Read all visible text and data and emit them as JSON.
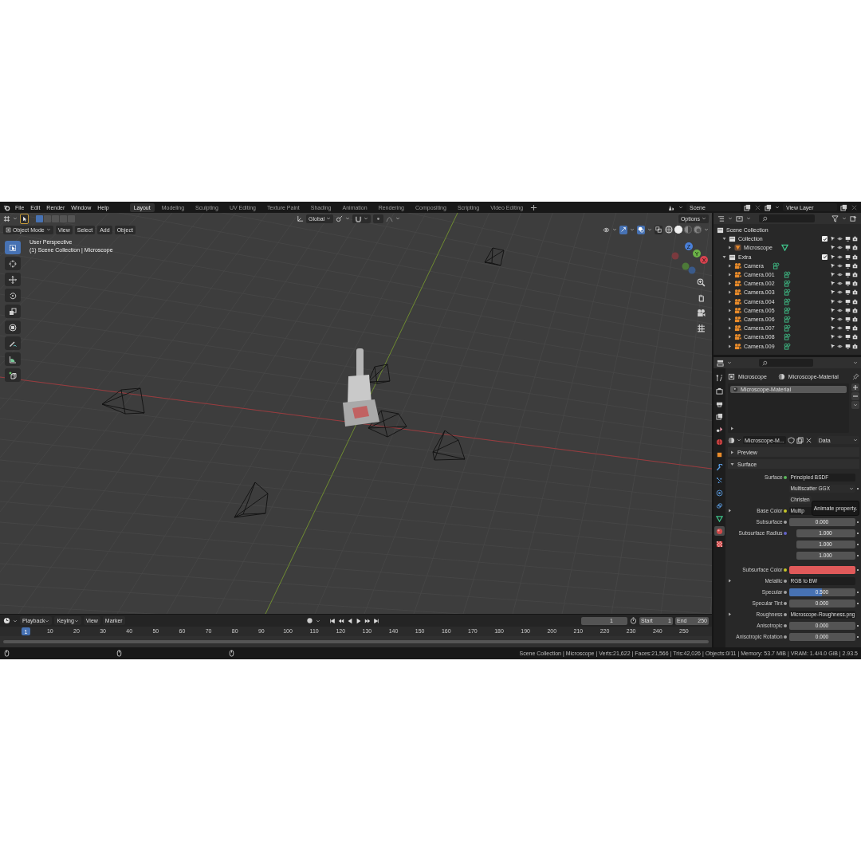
{
  "topbar": {
    "menus": [
      "File",
      "Edit",
      "Render",
      "Window",
      "Help"
    ],
    "workspaces": [
      {
        "label": "Layout",
        "selected": true
      },
      {
        "label": "Modeling",
        "selected": false
      },
      {
        "label": "Sculpting",
        "selected": false
      },
      {
        "label": "UV Editing",
        "selected": false
      },
      {
        "label": "Texture Paint",
        "selected": false
      },
      {
        "label": "Shading",
        "selected": false
      },
      {
        "label": "Animation",
        "selected": false
      },
      {
        "label": "Rendering",
        "selected": false
      },
      {
        "label": "Compositing",
        "selected": false
      },
      {
        "label": "Scripting",
        "selected": false
      },
      {
        "label": "Video Editing",
        "selected": false
      }
    ],
    "scene": "Scene",
    "view_layer": "View Layer"
  },
  "viewport": {
    "select_modes": [
      {
        "selected": true
      },
      {
        "selected": false
      },
      {
        "selected": false
      },
      {
        "selected": false
      },
      {
        "selected": false
      }
    ],
    "orientation": "Global",
    "snap_on": false,
    "proportional_on": false,
    "options": "Options",
    "mode": "Object Mode",
    "menus": [
      "View",
      "Select",
      "Add",
      "Object"
    ],
    "toggles": [
      {
        "kind": "gizmo",
        "on": true
      },
      {
        "kind": "overlay",
        "on": true
      },
      {
        "kind": "xray",
        "on": false
      }
    ],
    "shading": [
      {
        "kind": "wireframe",
        "selected": false
      },
      {
        "kind": "solid",
        "selected": true
      },
      {
        "kind": "material",
        "selected": false
      },
      {
        "kind": "rendered",
        "selected": false
      }
    ],
    "info": [
      "User Perspective",
      "(1) Scene Collection | Microscope"
    ],
    "tools": [
      {
        "kind": "select",
        "selected": true
      },
      {
        "kind": "cursor",
        "selected": false
      },
      {
        "kind": "move",
        "selected": false
      },
      {
        "kind": "rotate",
        "selected": false
      },
      {
        "kind": "scale",
        "selected": false
      },
      {
        "kind": "transform",
        "selected": false
      },
      {
        "kind": "annotate",
        "selected": false
      },
      {
        "kind": "measure",
        "selected": false
      },
      {
        "kind": "add_cube",
        "selected": false
      }
    ],
    "gizmo_axes": [
      "Z",
      "Y",
      "X"
    ]
  },
  "outliner": {
    "root": {
      "label": "Scene Collection",
      "children": [
        {
          "label": "Collection",
          "kind": "collection",
          "expanded": true,
          "checked": true,
          "children": [
            {
              "label": "Microscope",
              "kind": "mesh",
              "expanded": false
            }
          ]
        },
        {
          "label": "Extra",
          "kind": "collection",
          "expanded": true,
          "checked": true,
          "children": [
            {
              "label": "Camera",
              "kind": "camera",
              "expanded": false
            },
            {
              "label": "Camera.001",
              "kind": "camera",
              "expanded": false
            },
            {
              "label": "Camera.002",
              "kind": "camera",
              "expanded": false
            },
            {
              "label": "Camera.003",
              "kind": "camera",
              "expanded": false
            },
            {
              "label": "Camera.004",
              "kind": "camera",
              "expanded": false
            },
            {
              "label": "Camera.005",
              "kind": "camera",
              "expanded": false
            },
            {
              "label": "Camera.006",
              "kind": "camera",
              "expanded": false
            },
            {
              "label": "Camera.007",
              "kind": "camera",
              "expanded": false
            },
            {
              "label": "Camera.008",
              "kind": "camera",
              "expanded": false
            },
            {
              "label": "Camera.009",
              "kind": "camera",
              "expanded": false
            }
          ]
        }
      ]
    }
  },
  "properties": {
    "tabs": [
      {
        "kind": "tool",
        "selected": false
      },
      {
        "kind": "render",
        "selected": false
      },
      {
        "kind": "output",
        "selected": false
      },
      {
        "kind": "view_layer",
        "selected": false
      },
      {
        "kind": "scene",
        "selected": false
      },
      {
        "kind": "world",
        "selected": false
      },
      {
        "kind": "object",
        "selected": false
      },
      {
        "kind": "modifiers",
        "selected": false
      },
      {
        "kind": "particles",
        "selected": false
      },
      {
        "kind": "physics",
        "selected": false
      },
      {
        "kind": "constraints",
        "selected": false
      },
      {
        "kind": "data",
        "selected": false
      },
      {
        "kind": "material",
        "selected": true
      },
      {
        "kind": "texture",
        "selected": false
      }
    ],
    "object": "Microscope",
    "material": "Microscope-Material",
    "slots": [
      {
        "label": "Microscope-Material",
        "selected": true
      }
    ],
    "datablock": "Microscope-M...",
    "link": "Data",
    "panels": [
      {
        "label": "Preview",
        "expanded": false
      },
      {
        "label": "Surface",
        "expanded": true
      }
    ],
    "rows": [
      {
        "kind": "link",
        "label": "Surface",
        "value": "Principled BSDF",
        "color": "#5cb85c"
      },
      {
        "kind": "dropdown",
        "value": "Multiscatter GGX"
      },
      {
        "kind": "field",
        "value": "Christen"
      },
      {
        "kind": "link",
        "label": "Base Color",
        "value": "Multip",
        "color": "#c7c729",
        "expanded": false
      },
      {
        "kind": "slider",
        "label": "Subsurface",
        "value": "0.000",
        "level": 0,
        "color": "#a1a1a1"
      },
      {
        "kind": "vector",
        "label": "Subsurface Radius",
        "values": [
          "1.000",
          "1.000",
          "1.000"
        ],
        "color": "#6363c7"
      },
      {
        "kind": "swatch",
        "label": "Subsurface Color",
        "color": "#e05a5a"
      },
      {
        "kind": "link",
        "label": "Metallic",
        "value": "RGB to BW",
        "color": "#a1a1a1",
        "expanded": false
      },
      {
        "kind": "slider",
        "label": "Specular",
        "value": "0.500",
        "level": 0.5,
        "color": "#a1a1a1"
      },
      {
        "kind": "slider",
        "label": "Specular Tint",
        "value": "0.000",
        "level": 0,
        "color": "#a1a1a1"
      },
      {
        "kind": "link",
        "label": "Roughness",
        "value": "Microscope-Roughness.png",
        "color": "#a1a1a1",
        "expanded": false
      },
      {
        "kind": "slider",
        "label": "Anisotropic",
        "value": "0.000",
        "level": 0,
        "color": "#a1a1a1"
      },
      {
        "kind": "slider",
        "label": "Anisotropic Rotation",
        "value": "0.000",
        "level": 0,
        "color": "#a1a1a1"
      }
    ],
    "tooltip": "Animate property."
  },
  "timeline": {
    "menus": [
      {
        "label": "Playback",
        "kind": "dropdown"
      },
      {
        "label": "Keying",
        "kind": "dropdown"
      },
      {
        "label": "View",
        "kind": "menu"
      },
      {
        "label": "Marker",
        "kind": "menu"
      }
    ],
    "current_frame": "1",
    "start_label": "Start",
    "start": "1",
    "end_label": "End",
    "end": "250",
    "playhead": "1",
    "ticks": [
      "10",
      "20",
      "30",
      "40",
      "50",
      "60",
      "70",
      "80",
      "90",
      "100",
      "110",
      "120",
      "130",
      "140",
      "150",
      "160",
      "170",
      "180",
      "190",
      "200",
      "210",
      "220",
      "230",
      "240",
      "250"
    ]
  },
  "status_bar": "Scene Collection | Microscope | Verts:21,622 | Faces:21,566 | Tris:42,026 | Objects:0/11 | Memory: 53.7 MiB | VRAM: 1.4/4.0 GiB | 2.93.5"
}
